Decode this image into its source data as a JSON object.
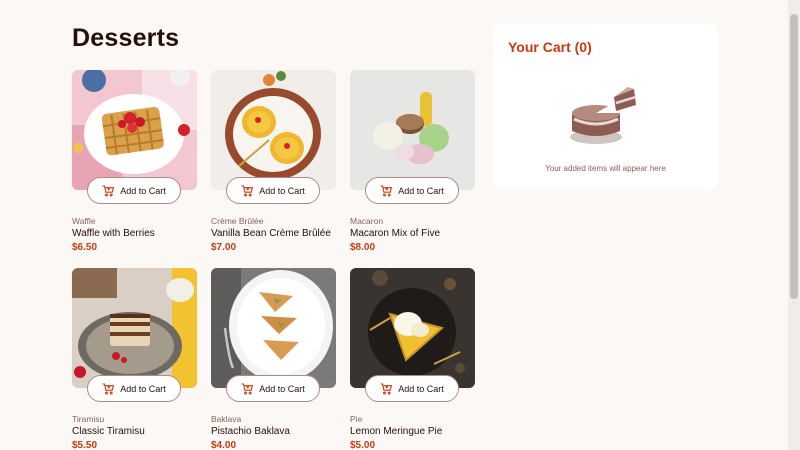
{
  "page_title": "Desserts",
  "products": [
    {
      "category": "Waffle",
      "name": "Waffle with Berries",
      "price": "$6.50",
      "button": "Add to Cart",
      "image_icon": "waffle-image"
    },
    {
      "category": "Crème Brûlée",
      "name": "Vanilla Bean Crème Brûlée",
      "price": "$7.00",
      "button": "Add to Cart",
      "image_icon": "creme-brulee-image"
    },
    {
      "category": "Macaron",
      "name": "Macaron Mix of Five",
      "price": "$8.00",
      "button": "Add to Cart",
      "image_icon": "macaron-image"
    },
    {
      "category": "Tiramisu",
      "name": "Classic Tiramisu",
      "price": "$5.50",
      "button": "Add to Cart",
      "image_icon": "tiramisu-image"
    },
    {
      "category": "Baklava",
      "name": "Pistachio Baklava",
      "price": "$4.00",
      "button": "Add to Cart",
      "image_icon": "baklava-image"
    },
    {
      "category": "Pie",
      "name": "Lemon Meringue Pie",
      "price": "$5.00",
      "button": "Add to Cart",
      "image_icon": "pie-image"
    }
  ],
  "cart": {
    "title": "Your Cart (0)",
    "empty_text": "Your added items will appear here",
    "illustration_icon": "empty-cake-icon"
  },
  "colors": {
    "background": "#fcf8f6",
    "accent": "#c73b0f",
    "text": "#260f08",
    "muted": "#87635a"
  }
}
